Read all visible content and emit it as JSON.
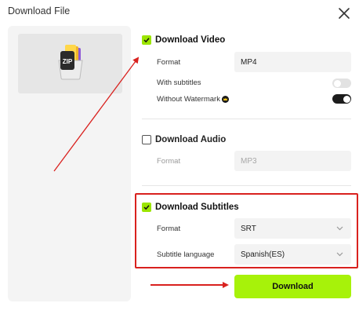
{
  "dialog": {
    "title": "Download File"
  },
  "video": {
    "title": "Download Video",
    "checked": true,
    "format_label": "Format",
    "format_value": "MP4",
    "subtitles_label": "With subtitles",
    "subtitles_on": false,
    "watermark_label": "Without Watermark",
    "watermark_on": true
  },
  "audio": {
    "title": "Download Audio",
    "checked": false,
    "format_label": "Format",
    "format_value": "MP3"
  },
  "subtitles": {
    "title": "Download Subtitles",
    "checked": true,
    "format_label": "Format",
    "format_value": "SRT",
    "language_label": "Subtitle language",
    "language_value": "Spanish(ES)"
  },
  "download_button": {
    "label": "Download"
  },
  "thumbnail": {
    "badge": "ZIP"
  },
  "colors": {
    "accent": "#a7f20a",
    "annotation": "#d9211e"
  }
}
